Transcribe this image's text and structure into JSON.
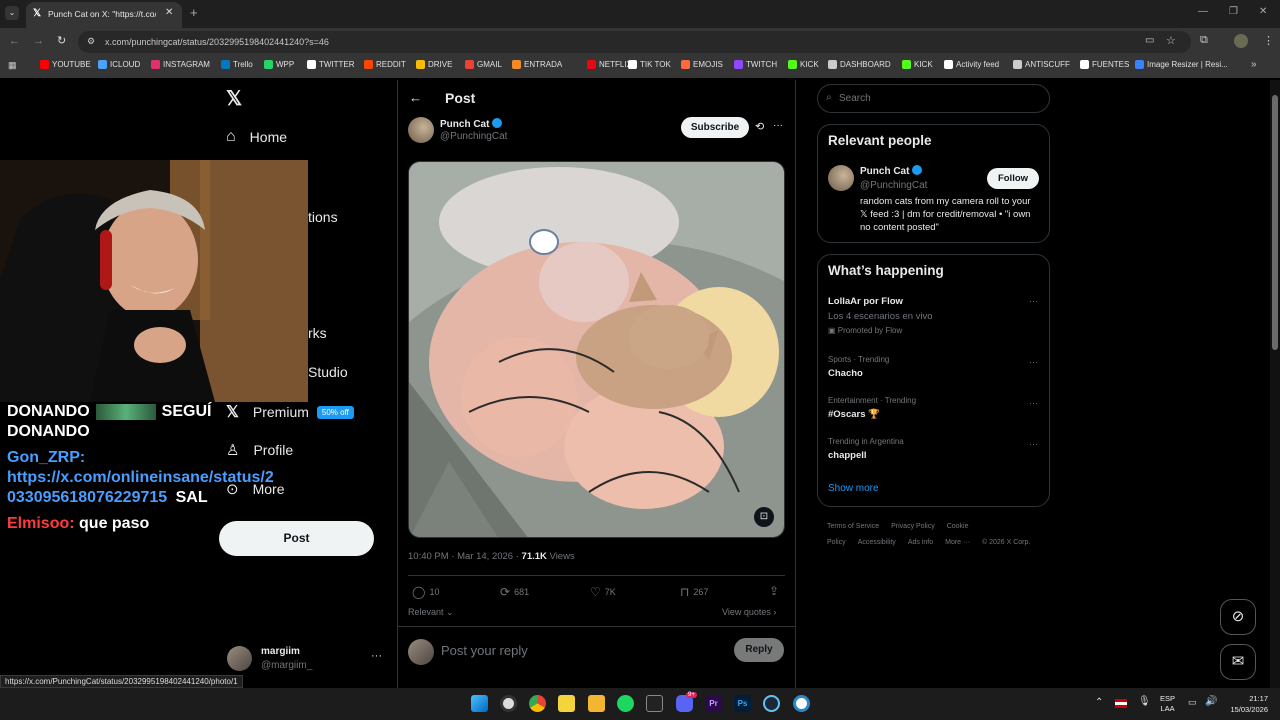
{
  "browser": {
    "tab_title": "Punch Cat on X: \"https://t.co/U...",
    "url": "x.com/punchingcat/status/2032995198402441240?s=46",
    "bookmarks": [
      "YOUTUBE",
      "ICLOUD",
      "INSTAGRAM",
      "Trello",
      "WPP",
      "TWITTER",
      "REDDIT",
      "DRIVE",
      "GMAIL",
      "ENTRADA",
      "NETFLIX",
      "TIK TOK",
      "EMOJIS",
      "TWITCH",
      "KICK",
      "DASHBOARD",
      "KICK",
      "Activity feed",
      "ANTISCUFF",
      "FUENTES",
      "Image Resizer | Resi..."
    ],
    "status_url": "https://x.com/PunchingCat/status/2032995198402441240/photo/1"
  },
  "nav": {
    "home": "Home",
    "notifications_partial": "tions",
    "bookmarks_partial": "rks",
    "studio_partial": "Studio",
    "premium": "Premium",
    "premium_badge": "50% off",
    "profile": "Profile",
    "more": "More",
    "post_button": "Post",
    "account_name": "margiim",
    "account_handle": "@margiim_"
  },
  "stream": {
    "line1_a": "DONANDO",
    "line1_b": "SEGUÍ",
    "line2": "DONANDO",
    "chat1_user": "Gon_ZRP:",
    "chat1_link1": "https://x.com/onlineinsane/status/2",
    "chat1_link2": "033095618076229715",
    "chat1_suffix": "SAL",
    "chat2_user": "Elmisoo:",
    "chat2_text": "que paso"
  },
  "post": {
    "header": "Post",
    "author_name": "Punch Cat",
    "author_handle": "@PunchingCat",
    "subscribe": "Subscribe",
    "meta_time": "10:40 PM · Mar 14, 2026 · ",
    "views_count": "71.1K",
    "views_label": " Views",
    "replies": "10",
    "reposts": "681",
    "likes": "7K",
    "bookmarks": "267",
    "relevant": "Relevant",
    "view_quotes": "View quotes",
    "reply_placeholder": "Post your reply",
    "reply_button": "Reply"
  },
  "sidebar": {
    "search_placeholder": "Search",
    "relevant_title": "Relevant people",
    "person_name": "Punch Cat",
    "person_handle": "@PunchingCat",
    "follow": "Follow",
    "person_bio": "random cats from my camera roll to your 𝕏 feed :3 | dm for credit/removal • \"i own no content posted\"",
    "happening_title": "What’s happening",
    "trends": [
      {
        "context": "",
        "title": "LollaAr por Flow",
        "sub": "Los 4 escenarios en vivo",
        "promo": "Promoted by Flow"
      },
      {
        "context": "Sports · Trending",
        "title": "Chacho",
        "sub": "",
        "promo": ""
      },
      {
        "context": "Entertainment · Trending",
        "title": "#Oscars 🏆",
        "sub": "",
        "promo": ""
      },
      {
        "context": "Trending in Argentina",
        "title": "chappell",
        "sub": "",
        "promo": ""
      }
    ],
    "show_more": "Show more",
    "footer_links": [
      "Terms of Service",
      "Privacy Policy",
      "Cookie Policy",
      "Accessibility",
      "Ads info",
      "More ···",
      "© 2026 X Corp."
    ]
  },
  "taskbar": {
    "lang": "ESP",
    "region": "LAA",
    "time": "21:17",
    "date": "15/03/2026",
    "discord_badge": "9+"
  },
  "colors": {
    "accent": "#1d9bf0",
    "chat_blue": "#4a9eff",
    "chat_red": "#ff3b3b"
  }
}
